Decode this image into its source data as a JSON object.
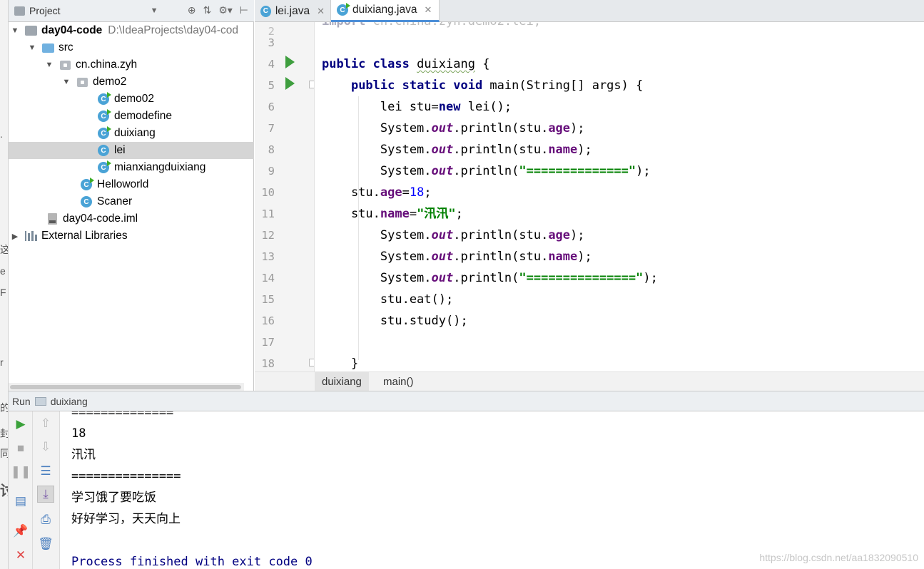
{
  "project_panel": {
    "title": "Project",
    "tree": [
      {
        "label": "day04-code",
        "path": "D:\\IdeaProjects\\day04-cod",
        "type": "project",
        "expanded": true
      },
      {
        "label": "src",
        "type": "source-folder",
        "expanded": true
      },
      {
        "label": "cn.china.zyh",
        "type": "package",
        "expanded": true
      },
      {
        "label": "demo2",
        "type": "package",
        "expanded": true
      },
      {
        "label": "demo02",
        "type": "class-runnable"
      },
      {
        "label": "demodefine",
        "type": "class-runnable"
      },
      {
        "label": "duixiang",
        "type": "class-runnable"
      },
      {
        "label": "lei",
        "type": "class",
        "selected": true
      },
      {
        "label": "mianxiangduixiang",
        "type": "class-runnable"
      },
      {
        "label": "Helloworld",
        "type": "class-runnable"
      },
      {
        "label": "Scaner",
        "type": "class"
      },
      {
        "label": "day04-code.iml",
        "type": "iml-file"
      },
      {
        "label": "External Libraries",
        "type": "libraries",
        "expanded": false
      }
    ]
  },
  "editor": {
    "tabs": [
      {
        "label": "lei.java",
        "active": false
      },
      {
        "label": "duixiang.java",
        "active": true
      }
    ],
    "lines": [
      {
        "n": "3",
        "text": ""
      },
      {
        "n": "4",
        "text": "public class duixiang {"
      },
      {
        "n": "5",
        "text": "    public static void main(String[] args) {"
      },
      {
        "n": "6",
        "text": "        lei stu=new lei();"
      },
      {
        "n": "7",
        "text": "        System.out.println(stu.age);"
      },
      {
        "n": "8",
        "text": "        System.out.println(stu.name);"
      },
      {
        "n": "9",
        "text": "        System.out.println(\"==============\");"
      },
      {
        "n": "10",
        "text": "    stu.age=18;"
      },
      {
        "n": "11",
        "text": "    stu.name=\"汛汛\";"
      },
      {
        "n": "12",
        "text": "        System.out.println(stu.age);"
      },
      {
        "n": "13",
        "text": "        System.out.println(stu.name);"
      },
      {
        "n": "14",
        "text": "        System.out.println(\"===============\");"
      },
      {
        "n": "15",
        "text": "        stu.eat();"
      },
      {
        "n": "16",
        "text": "        stu.study();"
      },
      {
        "n": "17",
        "text": ""
      },
      {
        "n": "18",
        "text": "    }"
      }
    ],
    "current_line": "16",
    "breadcrumb": [
      "duixiang",
      "main()"
    ]
  },
  "run_panel": {
    "label": "Run",
    "config": "duixiang",
    "output": [
      "==============",
      "18",
      "汛汛",
      "===============",
      "学习饿了要吃饭",
      "好好学习，天天向上",
      "",
      "Process finished with exit code 0"
    ]
  },
  "watermark": "https://blog.csdn.net/aa1832090510",
  "colors": {
    "keyword": "#000080",
    "field": "#660e7a",
    "string": "#008000",
    "number": "#0000ff",
    "current_line": "#fcf8e0"
  }
}
